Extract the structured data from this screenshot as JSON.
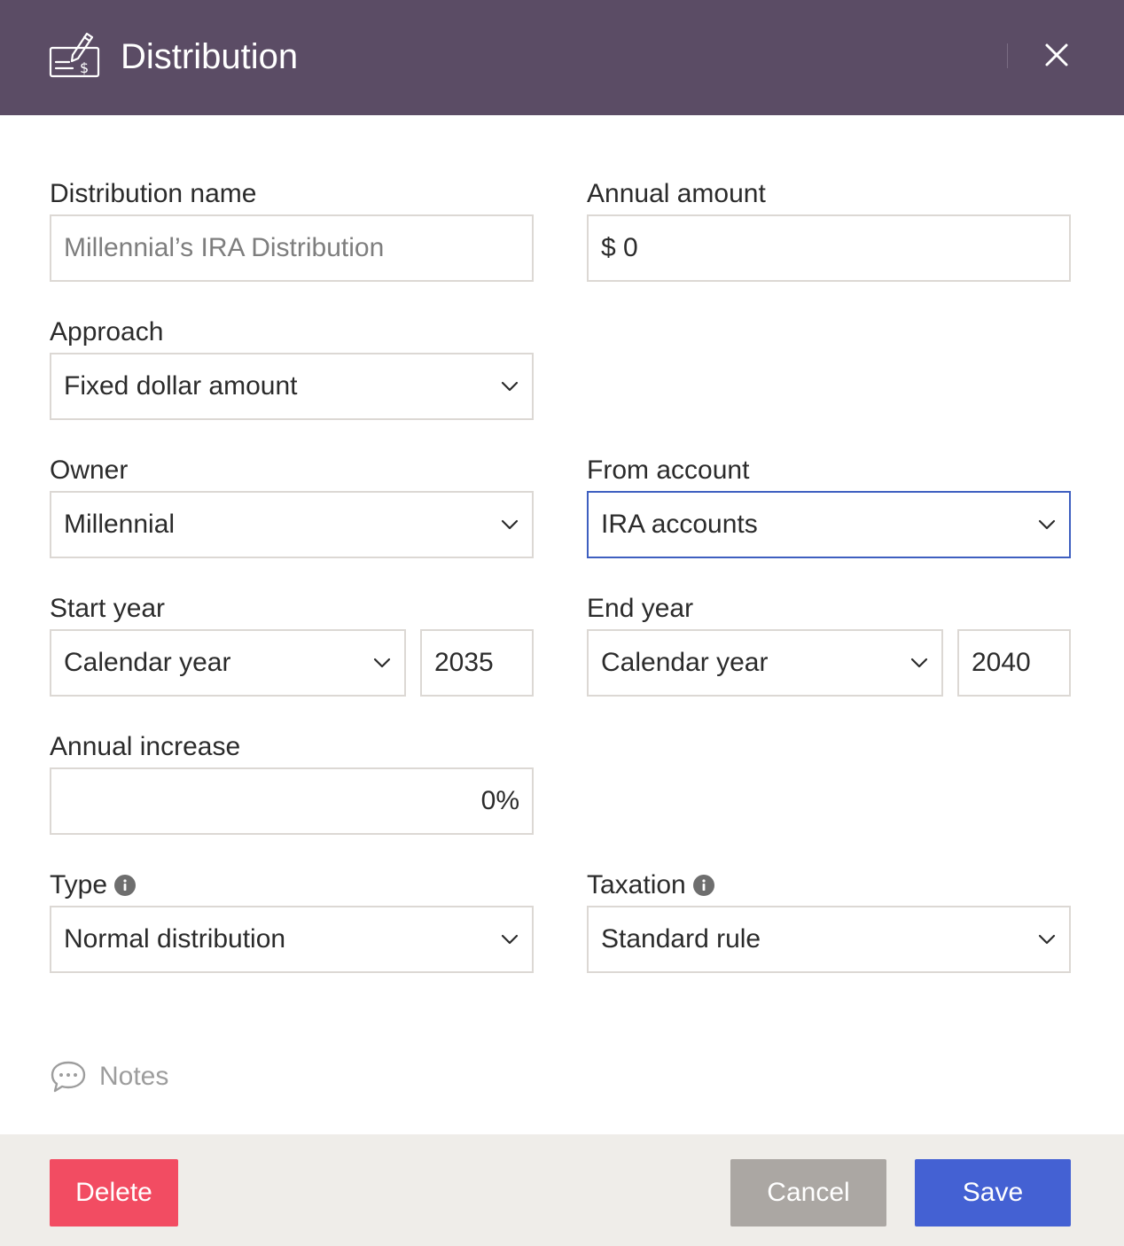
{
  "header": {
    "title": "Distribution",
    "icon": "check-writing-icon",
    "close_icon": "close-icon"
  },
  "form": {
    "distribution_name": {
      "label": "Distribution name",
      "placeholder": "Millennial’s IRA Distribution"
    },
    "annual_amount": {
      "label": "Annual amount",
      "value": "$ 0"
    },
    "approach": {
      "label": "Approach",
      "value": "Fixed dollar amount"
    },
    "owner": {
      "label": "Owner",
      "value": "Millennial"
    },
    "from_account": {
      "label": "From account",
      "value": "IRA accounts"
    },
    "start_year": {
      "label": "Start year",
      "mode": "Calendar year",
      "year": "2035"
    },
    "end_year": {
      "label": "End year",
      "mode": "Calendar year",
      "year": "2040"
    },
    "annual_increase": {
      "label": "Annual increase",
      "value": "0%"
    },
    "type": {
      "label": "Type",
      "value": "Normal distribution"
    },
    "taxation": {
      "label": "Taxation",
      "value": "Standard rule"
    }
  },
  "notes": {
    "label": "Notes"
  },
  "footer": {
    "delete_label": "Delete",
    "cancel_label": "Cancel",
    "save_label": "Save"
  },
  "colors": {
    "header_bg": "#5b4c65",
    "focus_border": "#3e5fc0",
    "delete_bg": "#f24c62",
    "cancel_bg": "#aba7a3",
    "save_bg": "#4461d3",
    "footer_bg": "#efede9"
  }
}
